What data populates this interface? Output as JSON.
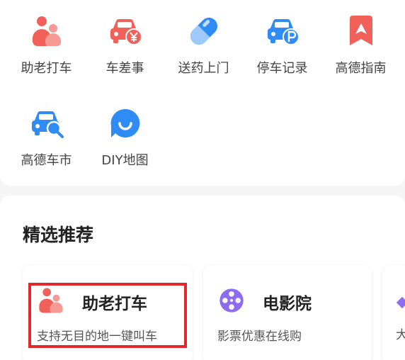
{
  "services": [
    {
      "label": "助老打车",
      "icon": "elderly-people-icon"
    },
    {
      "label": "车差事",
      "icon": "car-yuan-icon"
    },
    {
      "label": "送药上门",
      "icon": "pill-icon"
    },
    {
      "label": "停车记录",
      "icon": "car-parking-icon"
    },
    {
      "label": "高德指南",
      "icon": "bookmark-guide-icon"
    },
    {
      "label": "高德车市",
      "icon": "car-search-icon"
    },
    {
      "label": "DIY地图",
      "icon": "smile-pin-icon"
    }
  ],
  "section": {
    "title": "精选推荐"
  },
  "cards": [
    {
      "title": "助老打车",
      "subtitle": "支持无目的地一键叫车",
      "icon": "elderly-people-icon"
    },
    {
      "title": "电影院",
      "subtitle": "影票优惠在线购",
      "icon": "film-reel-icon"
    },
    {
      "title": "",
      "subtitle": "大",
      "icon": "diamond-icon"
    }
  ],
  "colors": {
    "red": "#f2605a",
    "blue": "#2f8cf5",
    "purple": "#8e6cf0",
    "highlight": "#e3282b"
  }
}
